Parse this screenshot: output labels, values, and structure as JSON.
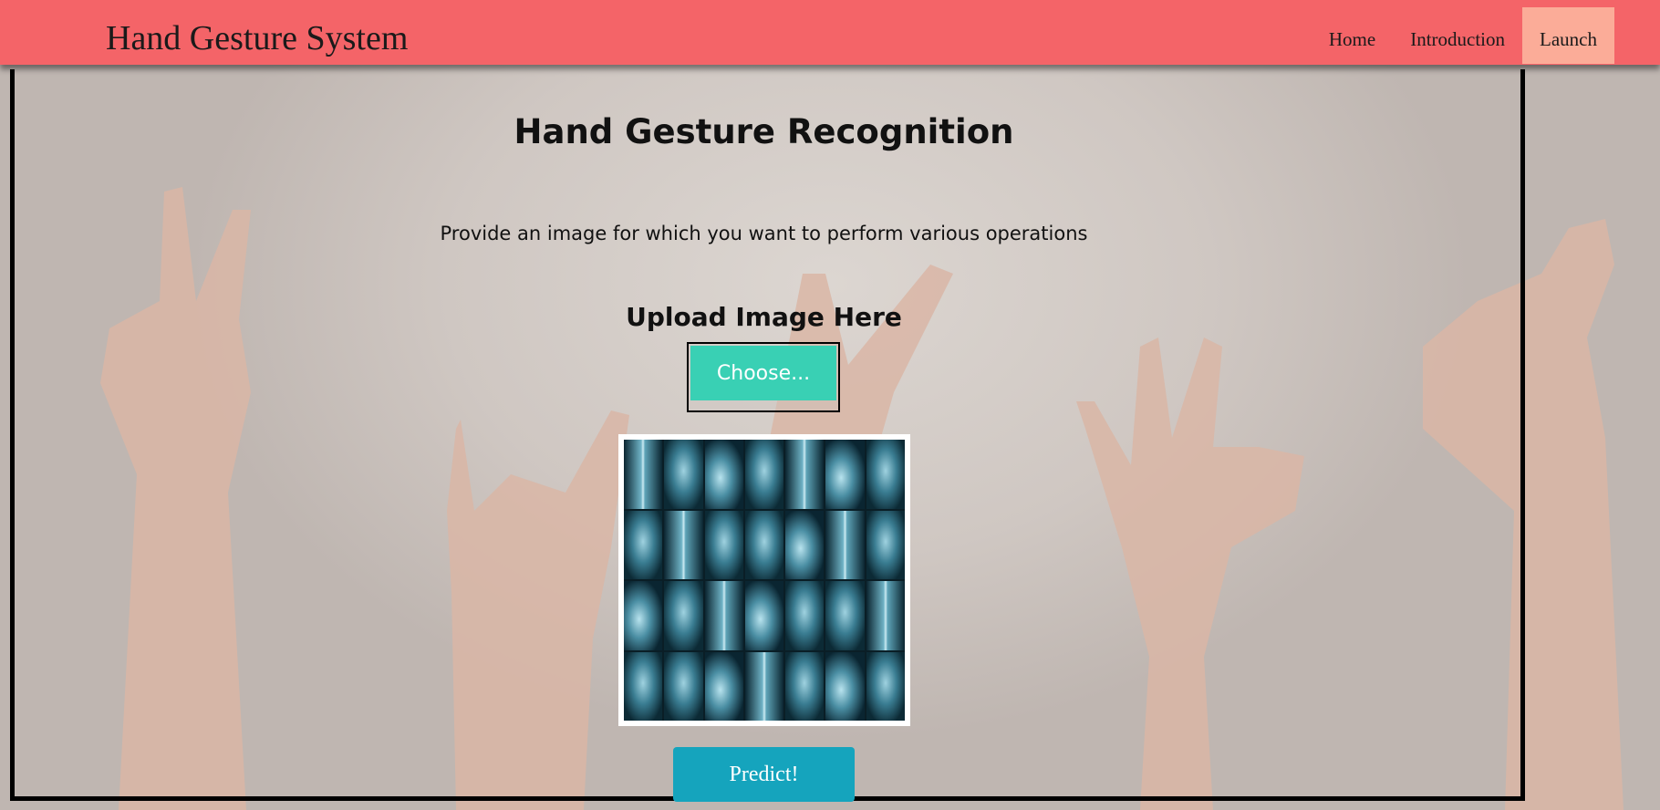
{
  "navbar": {
    "brand": "Hand Gesture System",
    "links": [
      {
        "label": "Home"
      },
      {
        "label": "Introduction"
      },
      {
        "label": "Launch",
        "active": true
      }
    ]
  },
  "main": {
    "title": "Hand Gesture Recognition",
    "subtitle": "Provide an image for which you want to perform various operations",
    "upload_heading": "Upload Image Here",
    "choose_label": "Choose...",
    "preview_image": "x-ray-collage",
    "predict_label": "Predict!"
  },
  "colors": {
    "navbar": "#f46468",
    "active_nav": "#fbac98",
    "choose_button": "#39d0b4",
    "predict_button": "#15a4bd"
  },
  "icons": {
    "background": "hand-gestures-photo"
  }
}
